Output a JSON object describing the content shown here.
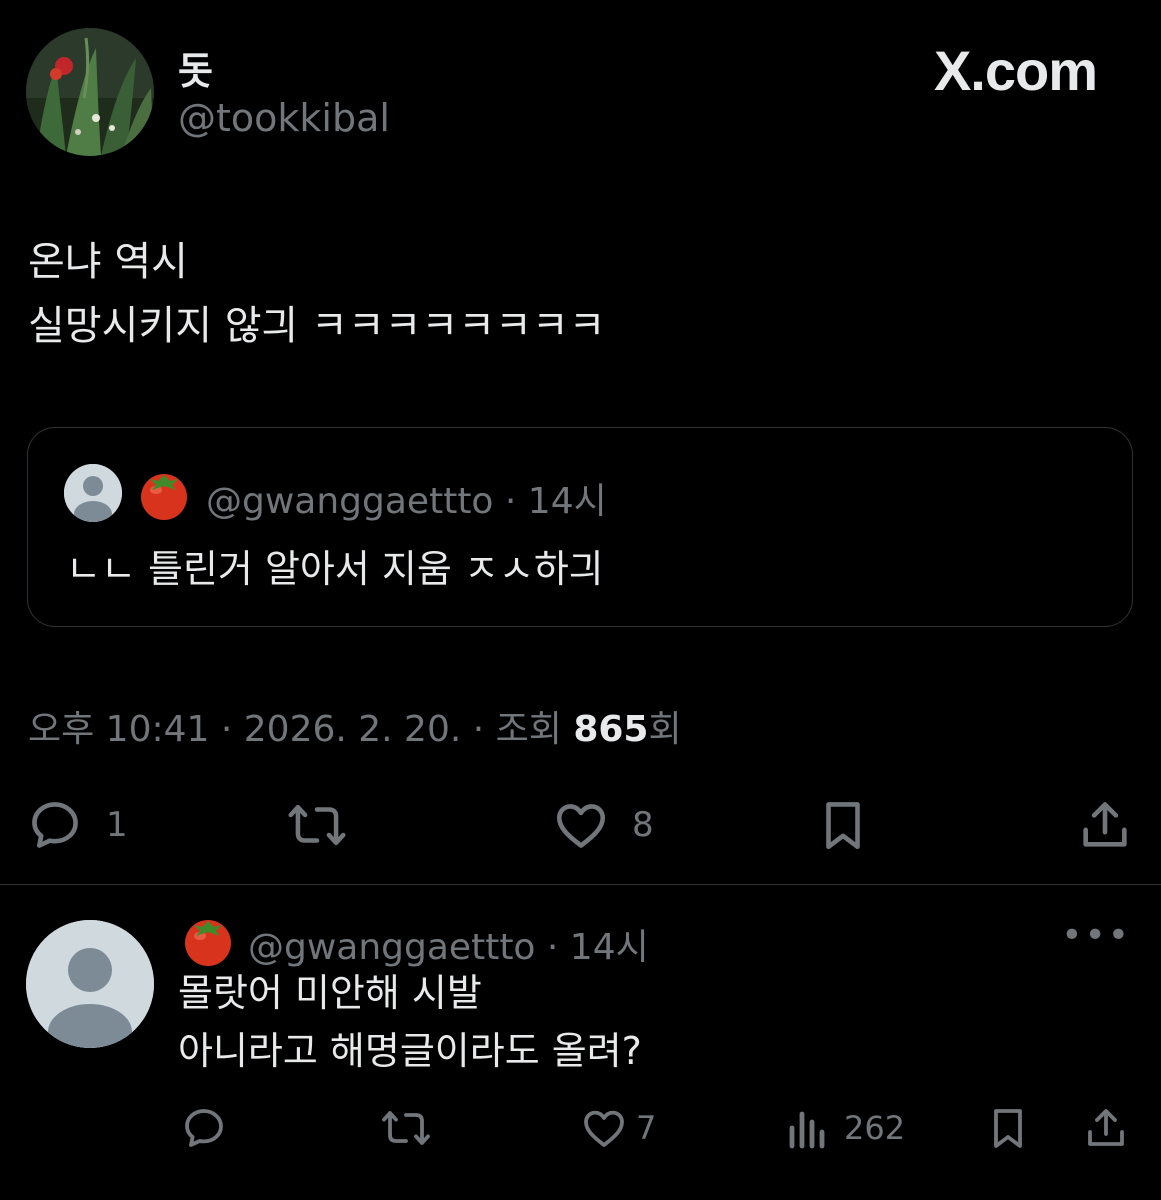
{
  "tweet": {
    "author_name": "돗",
    "author_handle": "@tookkibal",
    "brand": "X.com",
    "text_lines": [
      "온냐 역시",
      "실망시키지 않긔 ㅋㅋㅋㅋㅋㅋㅋㅋ"
    ],
    "quote": {
      "emoji": "tomato-icon",
      "handle": "@gwanggaettto",
      "time": "· 14시",
      "text": "ㄴㄴ 틀린거 알아서 지움 ㅈㅅ하긔"
    },
    "meta": {
      "time_date": "오후 10:41 · 2026. 2. 20. · 조회 ",
      "views": "865",
      "views_suffix": "회"
    },
    "actions": {
      "reply_count": "1",
      "retweet_count": "",
      "like_count": "8"
    }
  },
  "reply": {
    "emoji": "tomato-icon",
    "handle": "@gwanggaettto",
    "time": "· 14시",
    "more": "•••",
    "text_lines": [
      "몰랏어 미안해 시발",
      "아니라고 해명글이라도 올려?"
    ],
    "actions": {
      "like_count": "7",
      "views_count": "262"
    }
  },
  "colors": {
    "background": "#000000",
    "text": "#e7e9ea",
    "muted": "#71767b",
    "border": "#2f3336"
  }
}
